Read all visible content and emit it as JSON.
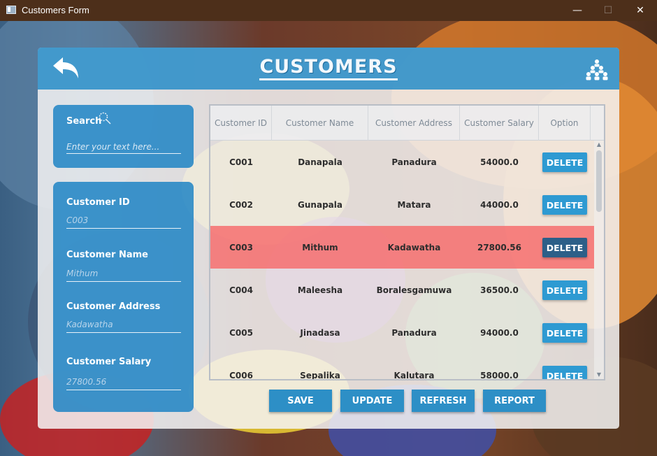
{
  "window": {
    "title": "Customers Form",
    "min_icon": "minimize-icon",
    "max_icon": "maximize-icon",
    "close_icon": "close-icon"
  },
  "header": {
    "title": "CUSTOMERS",
    "back_icon": "back-arrow-icon",
    "people_icon": "people-group-icon"
  },
  "search": {
    "label": "Search",
    "placeholder": "Enter your text here...",
    "icon": "search-icon"
  },
  "form": {
    "customer_id_label": "Customer ID",
    "customer_id_value": "C003",
    "customer_name_label": "Customer Name",
    "customer_name_value": "Mithum",
    "customer_address_label": "Customer Address",
    "customer_address_value": "Kadawatha",
    "customer_salary_label": "Customer Salary",
    "customer_salary_value": "27800.56"
  },
  "table": {
    "columns": [
      "Customer ID",
      "Customer Name",
      "Customer Address",
      "Customer Salary",
      "Option"
    ],
    "delete_label": "DELETE",
    "rows": [
      {
        "id": "C001",
        "name": "Danapala",
        "address": "Panadura",
        "salary": "54000.0"
      },
      {
        "id": "C002",
        "name": "Gunapala",
        "address": "Matara",
        "salary": "44000.0"
      },
      {
        "id": "C003",
        "name": "Mithum",
        "address": "Kadawatha",
        "salary": "27800.56"
      },
      {
        "id": "C004",
        "name": "Maleesha",
        "address": "Boralesgamuwa",
        "salary": "36500.0"
      },
      {
        "id": "C005",
        "name": "Jinadasa",
        "address": "Panadura",
        "salary": "94000.0"
      },
      {
        "id": "C006",
        "name": "Sepalika",
        "address": "Kalutara",
        "salary": "58000.0"
      }
    ]
  },
  "buttons": {
    "save": "SAVE",
    "update": "UPDATE",
    "refresh": "REFRESH",
    "report": "REPORT"
  },
  "colors": {
    "accent": "#2c8ec8",
    "selected_row": "#f66a6a",
    "titlebar": "#4d2f1a"
  }
}
